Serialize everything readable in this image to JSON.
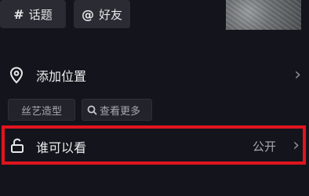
{
  "chips": {
    "topic": {
      "symbol": "#",
      "label": "话题"
    },
    "friend": {
      "symbol": "@",
      "label": "好友"
    }
  },
  "location": {
    "label": "添加位置",
    "icon": "location-pin-icon"
  },
  "tags": {
    "style": "丝艺造型",
    "more": "查看更多"
  },
  "privacy": {
    "label": "谁可以看",
    "value": "公开",
    "icon": "unlock-icon"
  },
  "colors": {
    "highlight": "#e1141e",
    "background": "#14151c"
  }
}
